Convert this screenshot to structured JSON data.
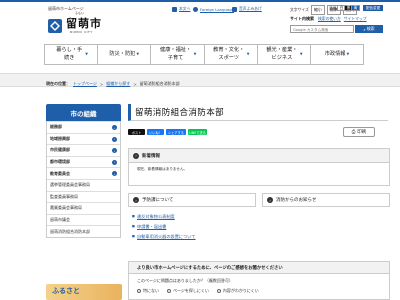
{
  "header": {
    "brand_small": "留萌市ホームページ",
    "logo_text": "留萌市",
    "logo_ruby": "るもい",
    "logo_en": "RUMOI CITY",
    "utility": [
      {
        "label": "本文へ",
        "color": "#1f5ea8",
        "icon": "arrow-icon"
      },
      {
        "label": "Foreign Language",
        "color": "#1f5ea8",
        "icon": "globe-icon"
      },
      {
        "label": "音声よみあげ",
        "color": "#1f5ea8",
        "icon": "speaker-icon"
      }
    ],
    "font_size_label": "文字サイズ",
    "font_size_buttons": [
      "縮小",
      "標準",
      "拡大"
    ],
    "background_label": "背景",
    "background_buttons": [
      "白",
      "黒",
      "青"
    ],
    "lang_button": "配色変更",
    "site_content_label": "サイト内検索",
    "site_links": [
      "検索の使い方",
      "サイトマップ"
    ],
    "search_placeholder": "Google カスタム検索",
    "search_button": "検索"
  },
  "gnav": [
    {
      "label": "暮らし・手続き"
    },
    {
      "label": "防災・防犯"
    },
    {
      "label": "健康・福祉・子育て"
    },
    {
      "label": "教育・文化・スポーツ"
    },
    {
      "label": "観光・産業・ビジネス"
    },
    {
      "label": "市政情報"
    }
  ],
  "breadcrumb": {
    "now_label": "現在の位置：",
    "items": [
      "トップページ",
      "組織から探す"
    ],
    "current": "留萌消防組合消防本部"
  },
  "sidebar": {
    "heading": "市の組織",
    "items": [
      {
        "label": "総務部",
        "bold": true
      },
      {
        "label": "地域振興部",
        "bold": true
      },
      {
        "label": "市民健康部",
        "bold": true
      },
      {
        "label": "都市環境部",
        "bold": true
      },
      {
        "label": "教育委員会",
        "bold": true
      },
      {
        "label": "選挙管理委員会事務局",
        "bold": false
      },
      {
        "label": "監査委員事務局",
        "bold": false
      },
      {
        "label": "農業委員会事務局",
        "bold": false
      },
      {
        "label": "留萌市議会",
        "bold": false
      },
      {
        "label": "留萌消防組合消防本部",
        "bold": false
      }
    ],
    "banner_text": "ふるさと"
  },
  "main": {
    "title": "留萌消防組合消防本部",
    "share_buttons": [
      {
        "label": "ポスト",
        "color": "#111111"
      },
      {
        "label": "いいね！",
        "color": "#1877f2"
      },
      {
        "label": "シェアする",
        "color": "#1877f2"
      },
      {
        "label": "LINEで送る",
        "color": "#06c755"
      }
    ],
    "print_label": "印刷",
    "news_heading": "新着情報",
    "news_body": "現在、新着情報はありません。",
    "panel_left": "予防課について",
    "panel_right": "消防からのお知らせ",
    "links": [
      "違反対象物公表制度",
      "申請書・届出書",
      "自動車用消火器の設置について"
    ],
    "survey": {
      "heading": "より良い市ホームページにするために、ページのご感想をお聞かせください",
      "question": "このページに問題点はありましたか？（複数回答可）",
      "options": [
        "特にない",
        "ページを探しにくい",
        "内容がわかりにくい"
      ]
    }
  }
}
